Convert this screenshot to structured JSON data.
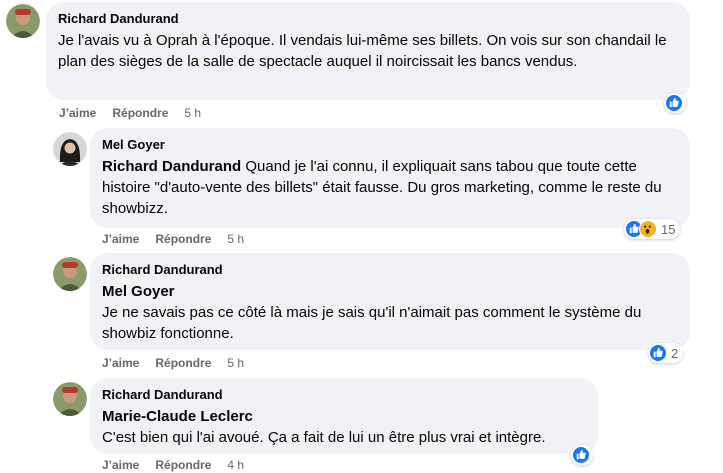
{
  "comments": [
    {
      "author": "Richard Dandurand",
      "mention": "",
      "text": "Je l'avais vu à Oprah à l'époque. Il vendais lui-même ses billets. On vois sur son chandail le plan des sièges de la salle de spectacle auquel il noircissait les bancs vendus.",
      "like_label": "J’aime",
      "reply_label": "Répondre",
      "time": "5 h",
      "reactions": [
        "like"
      ],
      "reaction_count": ""
    },
    {
      "author": "Mel Goyer",
      "mention": "Richard Dandurand",
      "text": "Quand je l'ai connu, il expliquait sans tabou que toute cette histoire \"d'auto-vente des billets\" était fausse. Du gros marketing, comme le reste du showbizz.",
      "like_label": "J’aime",
      "reply_label": "Répondre",
      "time": "5 h",
      "reactions": [
        "like",
        "wow"
      ],
      "reaction_count": "15"
    },
    {
      "author": "Richard Dandurand",
      "mention": "Mel Goyer",
      "text": "Je ne savais pas ce côté là mais je sais qu'il n'aimait pas comment le système du showbiz fonctionne.",
      "like_label": "J’aime",
      "reply_label": "Répondre",
      "time": "5 h",
      "reactions": [
        "like"
      ],
      "reaction_count": "2"
    },
    {
      "author": "Richard Dandurand",
      "mention": "Marie-Claude Leclerc",
      "text": "C'est bien qui l'ai avoué. Ça a fait de lui un être plus vrai et intègre.",
      "like_label": "J’aime",
      "reply_label": "Répondre",
      "time": "4 h",
      "reactions": [
        "like"
      ],
      "reaction_count": ""
    }
  ],
  "colors": {
    "bubble": "#f0f2f5",
    "like": "#1877f2",
    "wow": "#f7b125",
    "meta": "#65676b"
  }
}
